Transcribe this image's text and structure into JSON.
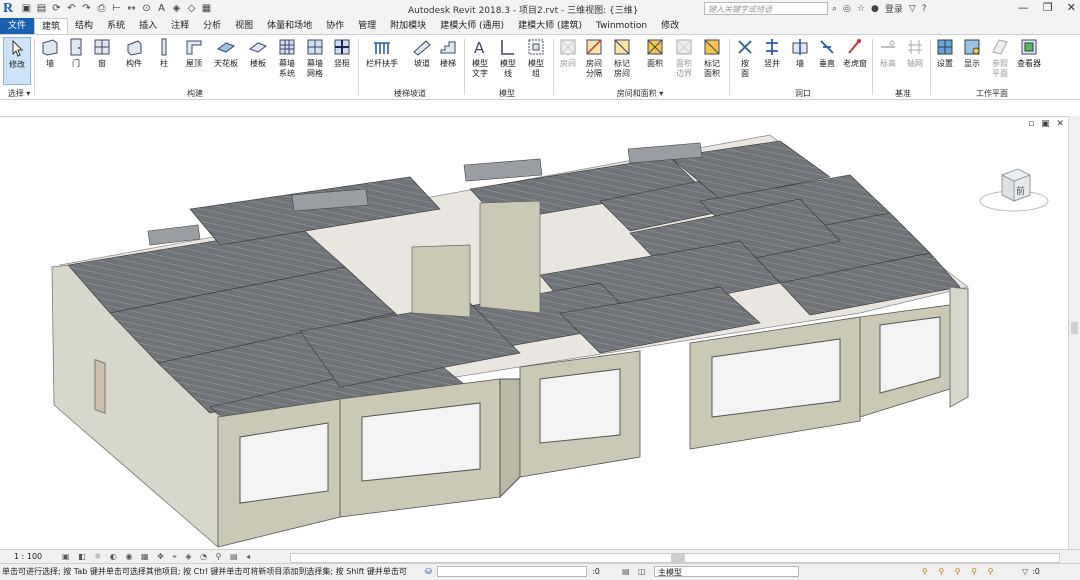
{
  "window": {
    "title": "Autodesk Revit 2018.3 -   项目2.rvt - 三维视图: {三维}",
    "search_placeholder": "键入关键字或短语",
    "login": "登录"
  },
  "tabs": [
    "文件",
    "建筑",
    "结构",
    "系统",
    "插入",
    "注释",
    "分析",
    "视图",
    "体量和场地",
    "协作",
    "管理",
    "附加模块",
    "建模大师 (通用)",
    "建模大师 (建筑)",
    "Twinmotion",
    "修改"
  ],
  "active_tab": "建筑",
  "ribbon": {
    "buttons": [
      {
        "label": "修改"
      },
      {
        "label": "墙"
      },
      {
        "label": "门"
      },
      {
        "label": "窗"
      },
      {
        "label": "构件"
      },
      {
        "label": "柱"
      },
      {
        "label": "屋顶"
      },
      {
        "label": "天花板"
      },
      {
        "label": "楼板"
      },
      {
        "label": "幕墙系统"
      },
      {
        "label": "幕墙网格"
      },
      {
        "label": "竖梃"
      },
      {
        "label": "栏杆扶手"
      },
      {
        "label": "坡道"
      },
      {
        "label": "楼梯"
      },
      {
        "label": "模型文字"
      },
      {
        "label": "模型线"
      },
      {
        "label": "模型组"
      },
      {
        "label": "房间"
      },
      {
        "label": "房间分隔"
      },
      {
        "label": "标记房间"
      },
      {
        "label": "面积"
      },
      {
        "label": "面积边界"
      },
      {
        "label": "标记面积"
      },
      {
        "label": "按面"
      },
      {
        "label": "竖井"
      },
      {
        "label": "墙"
      },
      {
        "label": "垂直"
      },
      {
        "label": "老虎窗"
      },
      {
        "label": "标高"
      },
      {
        "label": "轴网"
      },
      {
        "label": "设置"
      },
      {
        "label": "显示"
      },
      {
        "label": "参照平面"
      },
      {
        "label": "查看器"
      }
    ],
    "groups": [
      "选择",
      "构建",
      "楼梯坡道",
      "模型",
      "房间和面积",
      "洞口",
      "基准",
      "工作平面"
    ]
  },
  "viewcube": {
    "face": "前"
  },
  "view_controls": {
    "scale": "1 : 100"
  },
  "status": {
    "hint": "单击可进行选择; 按 Tab 键并单击可选择其他项目; 按 Ctrl 键并单击可将新项目添加到选择集; 按 Shift 键并单击可",
    "sel_count": ":0",
    "model": "主模型",
    "filter": ":0"
  },
  "colors": {
    "accent": "#1b5fb0",
    "wall": "#c9c9b6",
    "slab": "#6e7175",
    "slab_edge": "#d8c5a0"
  }
}
